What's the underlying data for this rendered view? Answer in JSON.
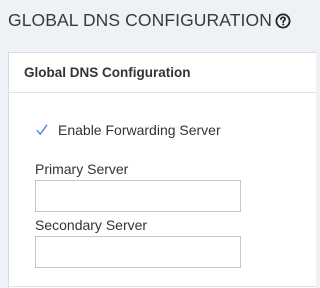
{
  "header": {
    "title": "GLOBAL DNS CONFIGURATION",
    "help_icon": "question-circle-icon"
  },
  "card": {
    "title": "Global DNS Configuration",
    "forwarding": {
      "label": "Enable Forwarding Server",
      "checked": true,
      "check_icon": "checkmark-icon"
    },
    "primary": {
      "label": "Primary Server",
      "value": ""
    },
    "secondary": {
      "label": "Secondary Server",
      "value": ""
    }
  },
  "colors": {
    "page_background": "#eef1f6",
    "card_background": "#ffffff",
    "checkmark": "#4a8bd6",
    "border": "#c6c6c6"
  }
}
